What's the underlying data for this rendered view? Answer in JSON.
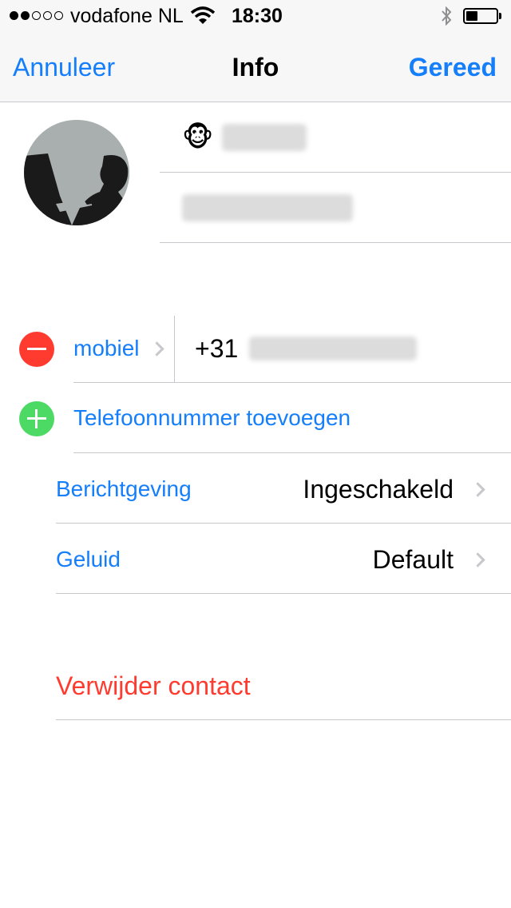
{
  "status_bar": {
    "signal_bars_filled": 2,
    "signal_bars_total": 5,
    "carrier": "vodafone NL",
    "time": "18:30",
    "icons": [
      "wifi-icon",
      "bluetooth-icon",
      "battery-icon"
    ],
    "battery_level": 0.4
  },
  "nav": {
    "cancel_label": "Annuleer",
    "title": "Info",
    "done_label": "Gereed"
  },
  "contact": {
    "first_name_emoji": "🐵"
  },
  "phone": {
    "label": "mobiel",
    "number_prefix": "+31"
  },
  "add_phone": {
    "label": "Telefoonnummer toevoegen"
  },
  "settings": [
    {
      "label": "Berichtgeving",
      "value": "Ingeschakeld"
    },
    {
      "label": "Geluid",
      "value": "Default"
    }
  ],
  "delete": {
    "label": "Verwijder contact"
  },
  "colors": {
    "accent": "#157efb",
    "delete": "#ff3b30",
    "remove_button": "#ff3b30",
    "add_button": "#4cd964"
  }
}
